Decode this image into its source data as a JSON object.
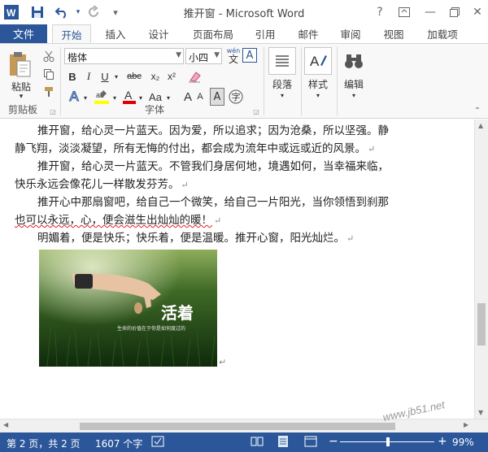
{
  "window": {
    "title": "推开窗 - Microsoft Word",
    "help": "?",
    "minimize": "—",
    "close": "✕"
  },
  "tabs": [
    "文件",
    "开始",
    "插入",
    "设计",
    "页面布局",
    "引用",
    "邮件",
    "审阅",
    "视图",
    "加载项"
  ],
  "ribbon": {
    "paste_label": "粘贴",
    "clipboard_group": "剪贴板",
    "font_group": "字体",
    "font_name": "楷体",
    "font_size": "小四",
    "wen_label": "wén",
    "wen_char": "文",
    "bold": "B",
    "italic": "I",
    "underline": "U",
    "strike": "abc",
    "subscript": "x₂",
    "superscript": "x²",
    "grow": "A",
    "shrink": "A",
    "case": "Aa",
    "char_border": "A",
    "char_shade": "字",
    "paragraph_label": "段落",
    "styles_label": "样式",
    "editing_label": "编辑",
    "colors": {
      "highlight": "#ffff00",
      "font_color": "#e00000",
      "accent": "#2b579a"
    }
  },
  "document": {
    "paragraphs": [
      {
        "indent": true,
        "text": "推开窗，给心灵一片蓝天。因为爱，所以追求；因为沧桑，所以坚强。静"
      },
      {
        "indent": false,
        "text": "静飞翔，淡淡凝望，所有无悔的付出，都会成为流年中或远或近的风景。"
      },
      {
        "indent": true,
        "text": "推开窗，给心灵一片蓝天。不管我们身居何地，境遇如何，当幸福来临，"
      },
      {
        "indent": false,
        "text": "快乐永远会像花儿一样散发芬芳。"
      },
      {
        "indent": true,
        "text": "推开心中那扇窗吧，给自己一个微笑，给自己一片阳光，当你领悟到刹那"
      },
      {
        "indent": false,
        "text": "也可以永远，心，便会滋生出灿灿的暖！"
      },
      {
        "indent": true,
        "text": "明媚着，便是快乐；快乐着，便是温暖。推开心窗，阳光灿烂。"
      }
    ],
    "image": {
      "title": "活着",
      "caption": "生命的价值在于你是如何度过的"
    }
  },
  "statusbar": {
    "page": "第 2 页，共 2 页",
    "words": "1607 个字",
    "zoom": "99%",
    "minus": "−",
    "plus": "+"
  },
  "watermark": "www.jb51.net"
}
